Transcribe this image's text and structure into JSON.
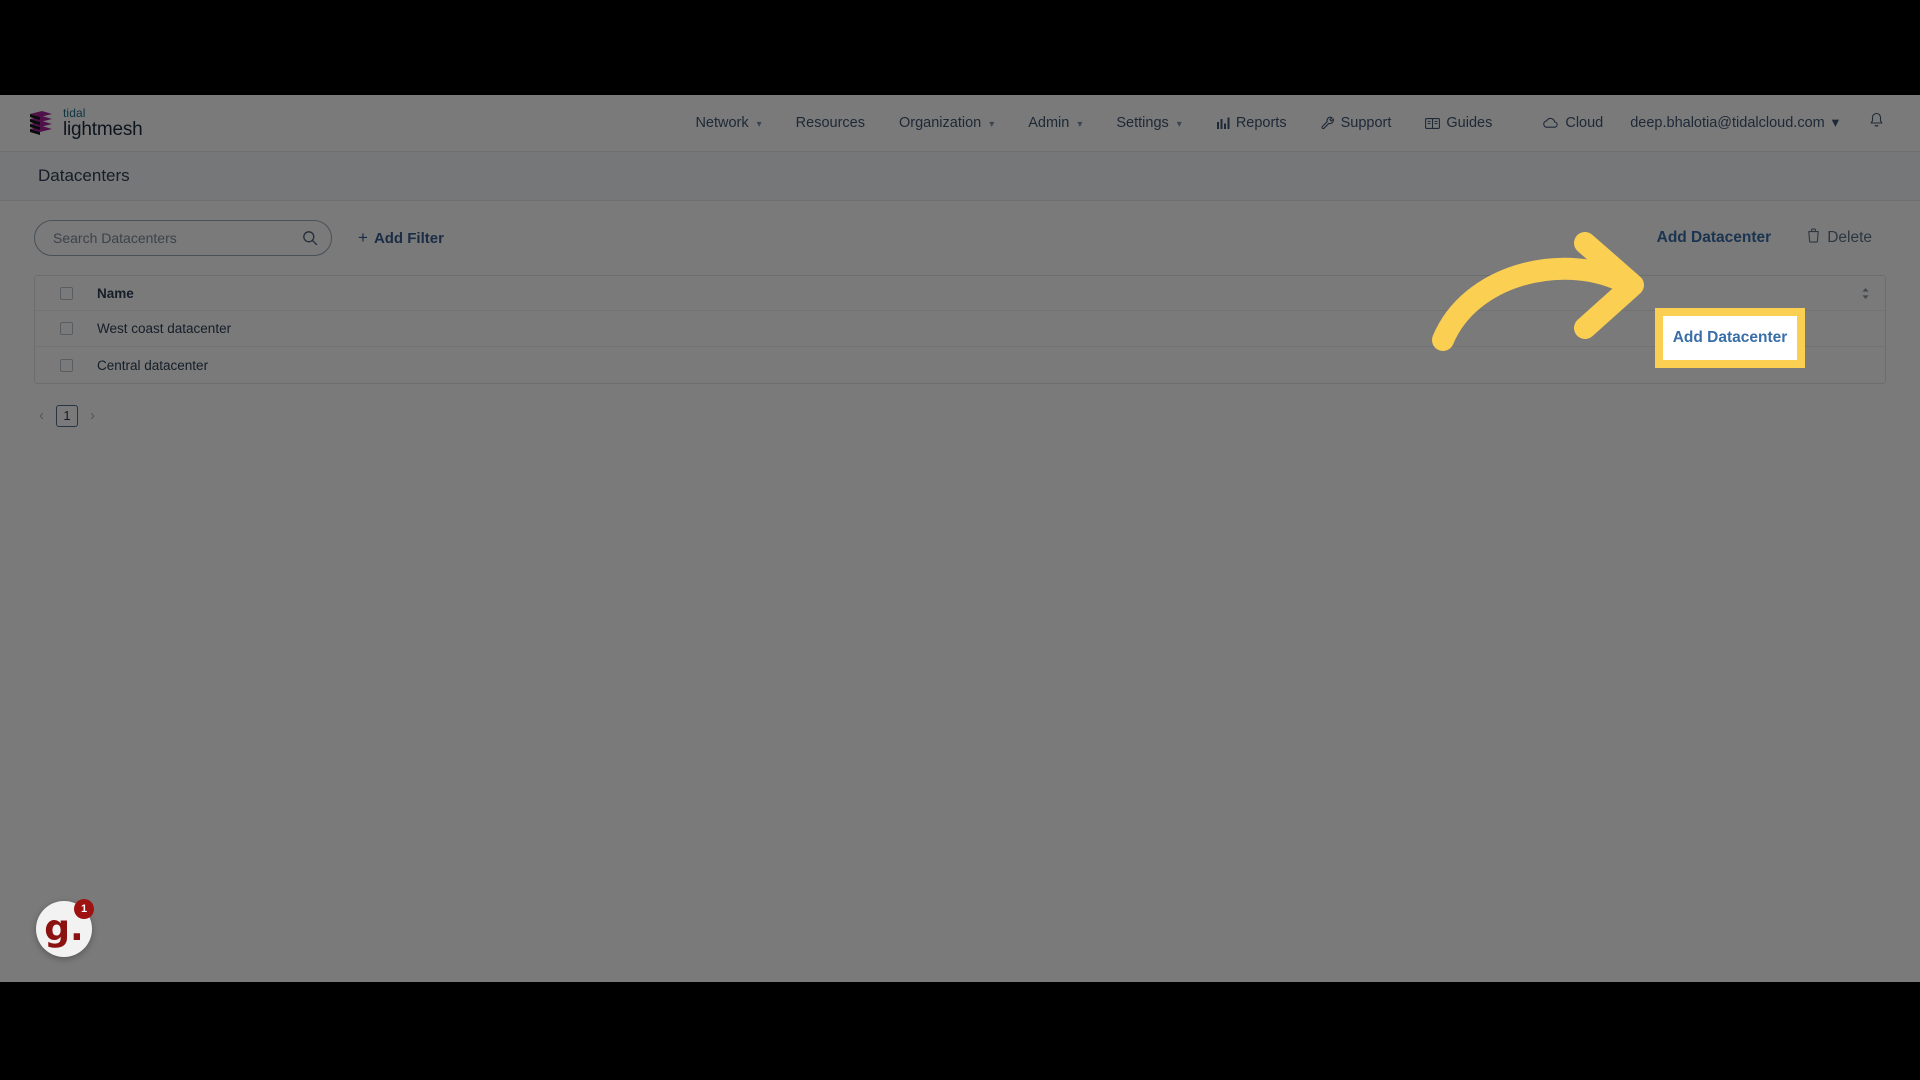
{
  "app": {
    "brand_top": "tidal",
    "brand_bottom": "lightmesh",
    "logo_icon": "tidal-lightmesh-logo-icon"
  },
  "topnav": {
    "items": [
      {
        "label": "Network",
        "has_caret": true,
        "icon": null
      },
      {
        "label": "Resources",
        "has_caret": false,
        "icon": null
      },
      {
        "label": "Organization",
        "has_caret": true,
        "icon": null
      },
      {
        "label": "Admin",
        "has_caret": true,
        "icon": null
      },
      {
        "label": "Settings",
        "has_caret": true,
        "icon": null
      },
      {
        "label": "Reports",
        "has_caret": false,
        "icon": "bar-chart-icon"
      },
      {
        "label": "Support",
        "has_caret": false,
        "icon": "wrench-icon"
      },
      {
        "label": "Guides",
        "has_caret": false,
        "icon": "book-icon"
      }
    ],
    "cloud": {
      "label": "Cloud",
      "icon": "cloud-icon"
    },
    "user": {
      "email": "deep.bhalotia@tidalcloud.com",
      "caret": "∨"
    },
    "notifications_icon": "bell-icon"
  },
  "page": {
    "title": "Datacenters"
  },
  "toolbar": {
    "search": {
      "placeholder": "Search Datacenters",
      "value": "",
      "icon": "search-icon"
    },
    "add_filter": {
      "label": "Add Filter",
      "plus": "+"
    },
    "add_datacenter": {
      "label": "Add Datacenter"
    },
    "delete": {
      "label": "Delete",
      "icon": "trash-icon"
    }
  },
  "table": {
    "columns": [
      "Name"
    ],
    "sort_icon": "sort-updown-icon",
    "rows": [
      {
        "name": "West coast datacenter",
        "selected": false
      },
      {
        "name": "Central datacenter",
        "selected": false
      }
    ],
    "header_selected": false
  },
  "pagination": {
    "prev": "‹",
    "next": "›",
    "pages": [
      "1"
    ],
    "current": "1"
  },
  "guidde": {
    "logo": "g.",
    "badge": "1"
  },
  "annotation": {
    "highlight_label": "Add Datacenter",
    "arrow_icon": "curved-arrow-right-icon",
    "colors": {
      "highlight": "#fbcf52",
      "arrow": "#fbcf52",
      "accent_link": "#3a6ea8",
      "brand_teal": "#1f6f87",
      "text_dark": "#2e4057"
    }
  }
}
